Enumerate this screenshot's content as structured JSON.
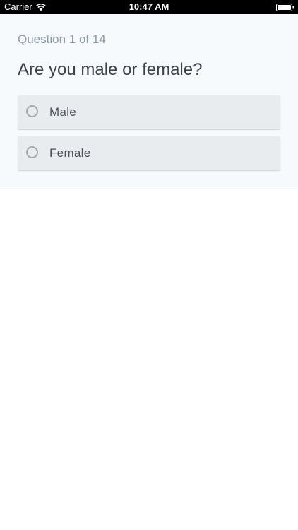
{
  "status_bar": {
    "carrier": "Carrier",
    "time": "10:47 AM",
    "wifi_icon": "wifi-icon",
    "battery_icon": "battery-icon"
  },
  "survey": {
    "counter": "Question 1 of 14",
    "question": "Are you male or female?",
    "options": [
      {
        "label": "Male",
        "selected": false
      },
      {
        "label": "Female",
        "selected": false
      }
    ]
  },
  "colors": {
    "panel_background": "#f6fafc",
    "option_background": "#e9ecee",
    "counter_text": "#8c9aa6",
    "question_text": "#3b434a",
    "option_text": "#4a5157",
    "radio_border": "#a5a8aa"
  }
}
